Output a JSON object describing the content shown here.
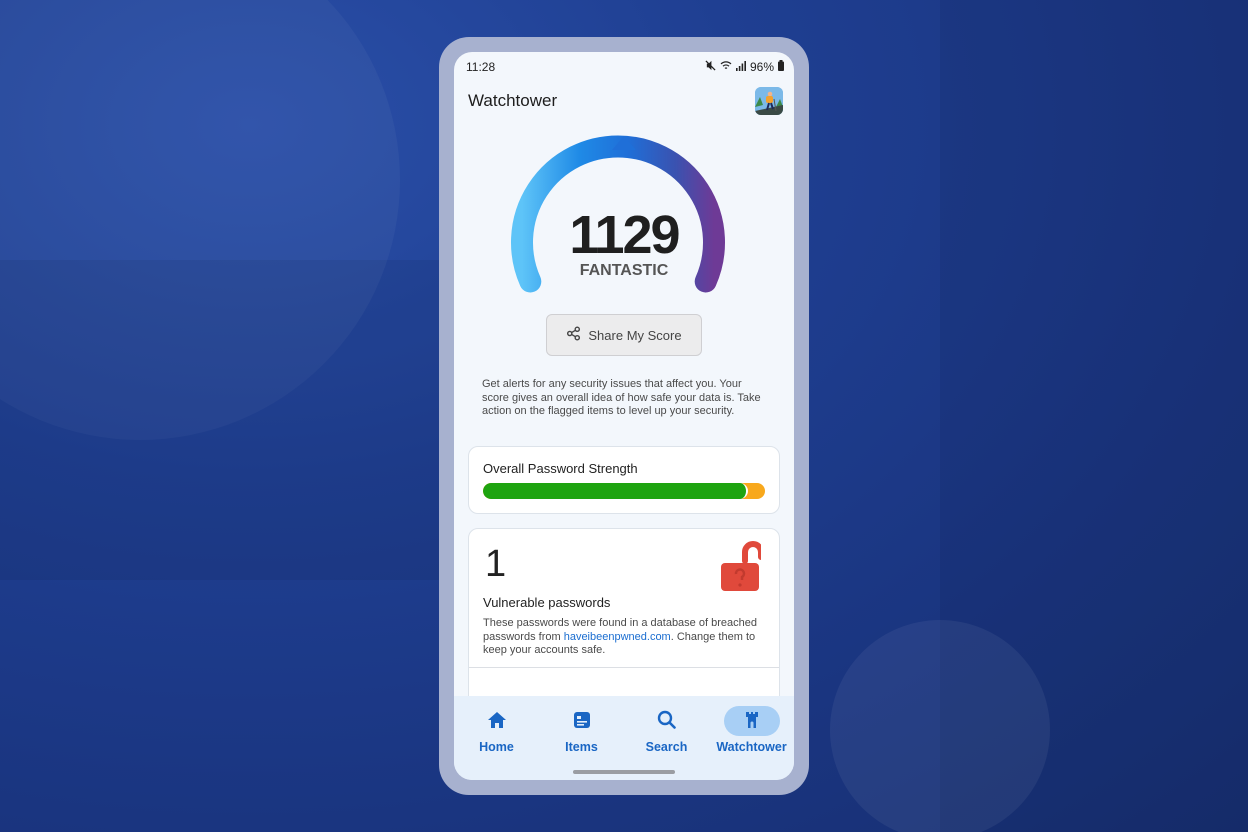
{
  "statusbar": {
    "time": "11:28",
    "battery": "96%",
    "icons": [
      "mute-icon",
      "wifi-icon",
      "signal-icon",
      "battery-icon"
    ]
  },
  "appbar": {
    "title": "Watchtower",
    "avatar_icon": "hiker-avatar"
  },
  "gauge": {
    "score": "1129",
    "rating": "FANTASTIC",
    "indicator_position": 0.5,
    "colors": [
      "#5ec4f8",
      "#1f7ee0",
      "#2860c8",
      "#3f4fae",
      "#6e3a96"
    ]
  },
  "share_button": {
    "label": "Share My Score",
    "icon": "share-icon"
  },
  "description": "Get alerts for any security issues that affect you. Your score gives an overall idea of how safe your data is. Take action on the flagged items to level up your security.",
  "password_strength": {
    "title": "Overall Password Strength",
    "strong_fraction": 0.94,
    "strong_color": "#1ea410",
    "weak_color": "#f8a81c"
  },
  "vulnerable": {
    "count": "1",
    "title": "Vulnerable passwords",
    "desc_before": "These passwords were found in a database of breached passwords from ",
    "link_text": "haveibeenpwned.com",
    "desc_after": ". Change them to keep your accounts safe.",
    "icon": "unlocked-padlock-alert-icon",
    "icon_color": "#e0493b"
  },
  "bottom_nav": {
    "items": [
      {
        "label": "Home",
        "icon": "home-icon",
        "active": false
      },
      {
        "label": "Items",
        "icon": "items-icon",
        "active": false
      },
      {
        "label": "Search",
        "icon": "search-icon",
        "active": false
      },
      {
        "label": "Watchtower",
        "icon": "watchtower-icon",
        "active": true
      }
    ],
    "accent": "#1a66c4"
  }
}
